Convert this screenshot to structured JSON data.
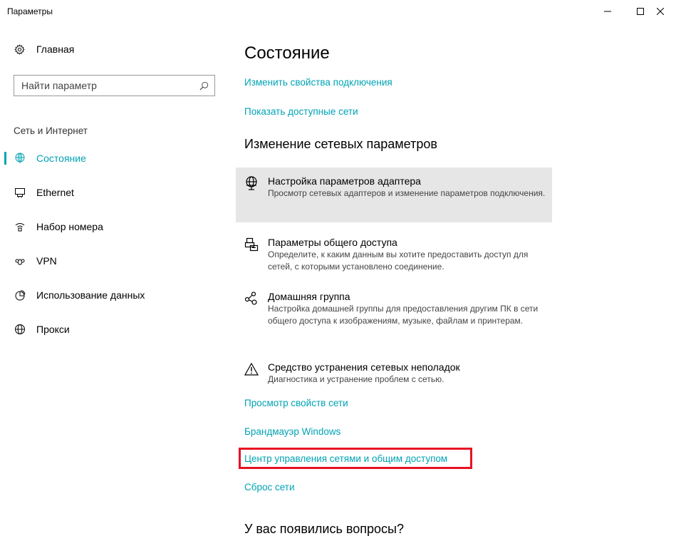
{
  "window": {
    "title": "Параметры",
    "minimize": "—",
    "maximize": "☐",
    "close": "✕"
  },
  "sidebar": {
    "home_label": "Главная",
    "search": {
      "placeholder": "Найти параметр",
      "value": ""
    },
    "section_label": "Сеть и Интернет",
    "items": [
      {
        "label": "Состояние",
        "icon": "globe-status-icon",
        "active": true
      },
      {
        "label": "Ethernet",
        "icon": "ethernet-icon",
        "active": false
      },
      {
        "label": "Набор номера",
        "icon": "dialup-icon",
        "active": false
      },
      {
        "label": "VPN",
        "icon": "vpn-icon",
        "active": false
      },
      {
        "label": "Использование данных",
        "icon": "data-usage-icon",
        "active": false
      },
      {
        "label": "Прокси",
        "icon": "globe-icon",
        "active": false
      }
    ]
  },
  "main": {
    "title": "Состояние",
    "links_top": [
      "Изменить свойства подключения",
      "Показать доступные сети"
    ],
    "section_heading": "Изменение сетевых параметров",
    "settings": [
      {
        "title": "Настройка параметров адаптера",
        "desc": "Просмотр сетевых адаптеров и изменение параметров подключения.",
        "icon": "adapter-icon"
      },
      {
        "title": "Параметры общего доступа",
        "desc": "Определите, к каким данным вы хотите предоставить доступ для сетей, с которыми установлено соединение.",
        "icon": "sharing-icon"
      },
      {
        "title": "Домашняя группа",
        "desc": "Настройка домашней группы для предоставления другим ПК в сети общего доступа к изображениям, музыке, файлам и принтерам.",
        "icon": "homegroup-icon"
      },
      {
        "title": "Средство устранения сетевых неполадок",
        "desc": "Диагностика и устранение проблем с сетью.",
        "icon": "warning-icon"
      }
    ],
    "links_bottom": [
      "Просмотр свойств сети",
      "Брандмауэр Windows",
      "Центр управления сетями и общим доступом",
      "Сброс сети"
    ],
    "question_heading": "У вас появились вопросы?"
  },
  "colors": {
    "accent": "#00a3b4",
    "highlight": "#e81123",
    "hover_bg": "#e6e6e6"
  }
}
